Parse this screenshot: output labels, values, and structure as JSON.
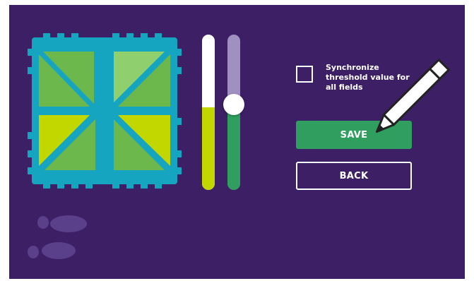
{
  "colors": {
    "background": "#3d1f66",
    "tile_frame": "#16a5c0",
    "tile_green": "#6cb84d",
    "tile_yellow": "#c2d600",
    "tile_highlight": "#8fcf6e",
    "slider_a_track": "#ffffff",
    "slider_a_fill": "#c2d600",
    "slider_b_track": "#a08fc1",
    "slider_b_fill": "#2f9e5e",
    "save_button": "#2f9e5e",
    "text": "#ffffff"
  },
  "sliders": [
    {
      "id": "slider-a",
      "level": 0.53
    },
    {
      "id": "slider-b",
      "level": 0.55
    }
  ],
  "sync": {
    "label": "Synchronize threshold value for all fields",
    "checked": false
  },
  "buttons": {
    "save_label": "SAVE",
    "back_label": "BACK"
  },
  "icons": {
    "pencil": "pencil-icon",
    "footprints": "footprints-icon",
    "checkbox": "checkbox-icon"
  }
}
